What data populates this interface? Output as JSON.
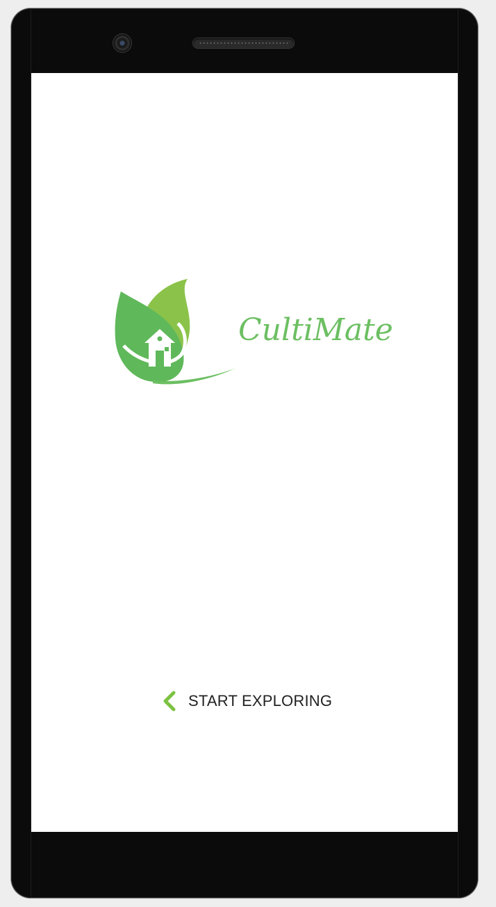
{
  "app": {
    "brand_name": "CultiMate",
    "brand_color": "#6cbf62",
    "leaf_dark": "#4caf50",
    "leaf_light": "#8bc34a"
  },
  "cta": {
    "label": "START EXPLORING",
    "icon": "chevron-left-icon",
    "icon_color": "#7cc242"
  },
  "device": {
    "frame_color": "#0b0b0b",
    "screen_color": "#ffffff"
  }
}
